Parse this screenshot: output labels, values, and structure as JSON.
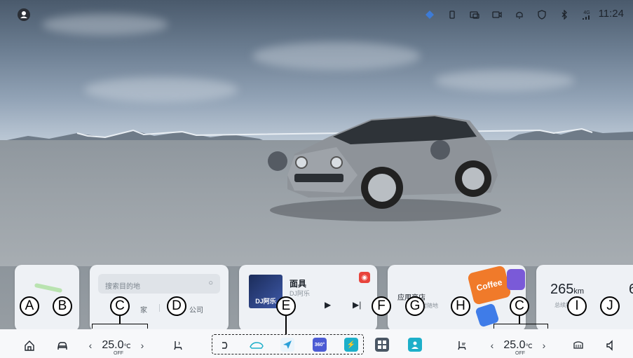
{
  "status_bar": {
    "time": "11:24",
    "signal_label": "4G",
    "icons": [
      "avatar-icon",
      "weather-icon",
      "phone-link-icon",
      "screen-share-icon",
      "camera-icon",
      "bell-icon",
      "shield-icon",
      "bluetooth-icon",
      "signal-icon"
    ]
  },
  "navigation_card": {
    "search_placeholder": "搜索目的地",
    "home_label": "家",
    "company_label": "公司"
  },
  "music_card": {
    "song_title": "面具",
    "artist": "DJ阿乐",
    "album_art_text": "DJ阿乐"
  },
  "apps_card": {
    "title": "应用商店",
    "subtitle": "随时随地",
    "promo_text": "Coffee"
  },
  "range_card": {
    "range_value": "265",
    "range_unit": "km",
    "range_caption": "总续航",
    "second_value_partial": "6"
  },
  "dock": {
    "left_temp": "25.0",
    "right_temp": "25.0",
    "temp_unit": "℃",
    "left_status": "OFF",
    "right_status": "OFF",
    "app_360_label": "360°"
  },
  "callouts": {
    "A": "A",
    "B": "B",
    "C_left": "C",
    "D": "D",
    "E": "E",
    "F": "F",
    "G": "G",
    "H": "H",
    "C_right": "C",
    "I": "I",
    "J": "J"
  },
  "colors": {
    "accent_blue": "#2a9fd8",
    "music_brand_red": "#e8443c",
    "app_teal": "#1dafc9"
  }
}
